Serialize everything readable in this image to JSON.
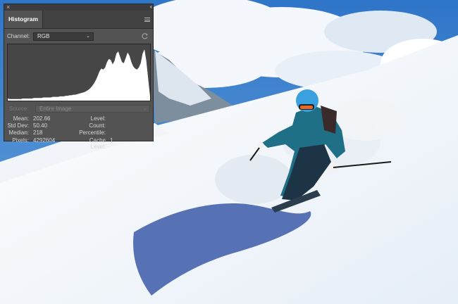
{
  "panel": {
    "close_glyph": "×",
    "collapse_glyph": "‹‹",
    "tab_label": "Histogram",
    "menu_icon": "panel-menu-icon",
    "channel": {
      "label": "Channel:",
      "value": "RGB",
      "chevron": "⌄"
    },
    "refresh_icon": "refresh-icon",
    "source": {
      "label": "Source:",
      "value": "Entire Image",
      "chevron": "⌄"
    }
  },
  "histogram": {
    "fill": "#ffffff",
    "graph_bg": "#464646",
    "levels": [
      4,
      3,
      3,
      3,
      3,
      3,
      3,
      3,
      4,
      4,
      4,
      4,
      4,
      4,
      5,
      5,
      5,
      5,
      5,
      6,
      6,
      6,
      6,
      6,
      7,
      7,
      7,
      7,
      8,
      8,
      8,
      9,
      9,
      10,
      10,
      11,
      11,
      12,
      13,
      14,
      15,
      16,
      18,
      20,
      23,
      27,
      32,
      38,
      46,
      55,
      60,
      58,
      62,
      72,
      78,
      76,
      68,
      74,
      88,
      92,
      82,
      72,
      70,
      80,
      90,
      84,
      72,
      64,
      60,
      58,
      62,
      70,
      88,
      96,
      74,
      40,
      8
    ]
  },
  "stats": {
    "mean_label": "Mean:",
    "mean_value": "202.66",
    "std_label": "Std Dev:",
    "std_value": "50.40",
    "median_label": "Median:",
    "median_value": "218",
    "pixels_label": "Pixels:",
    "pixels_value": "4292604",
    "level_label": "Level:",
    "level_value": "",
    "count_label": "Count:",
    "count_value": "",
    "percentile_label": "Percentile:",
    "percentile_value": "",
    "cache_label": "Cache Level:",
    "cache_value": "1"
  },
  "photo": {
    "sky": "#2a6fc4",
    "snow": "#eef3f8",
    "jacket": "#1f6f87",
    "helmet": "#3aa0e0"
  }
}
